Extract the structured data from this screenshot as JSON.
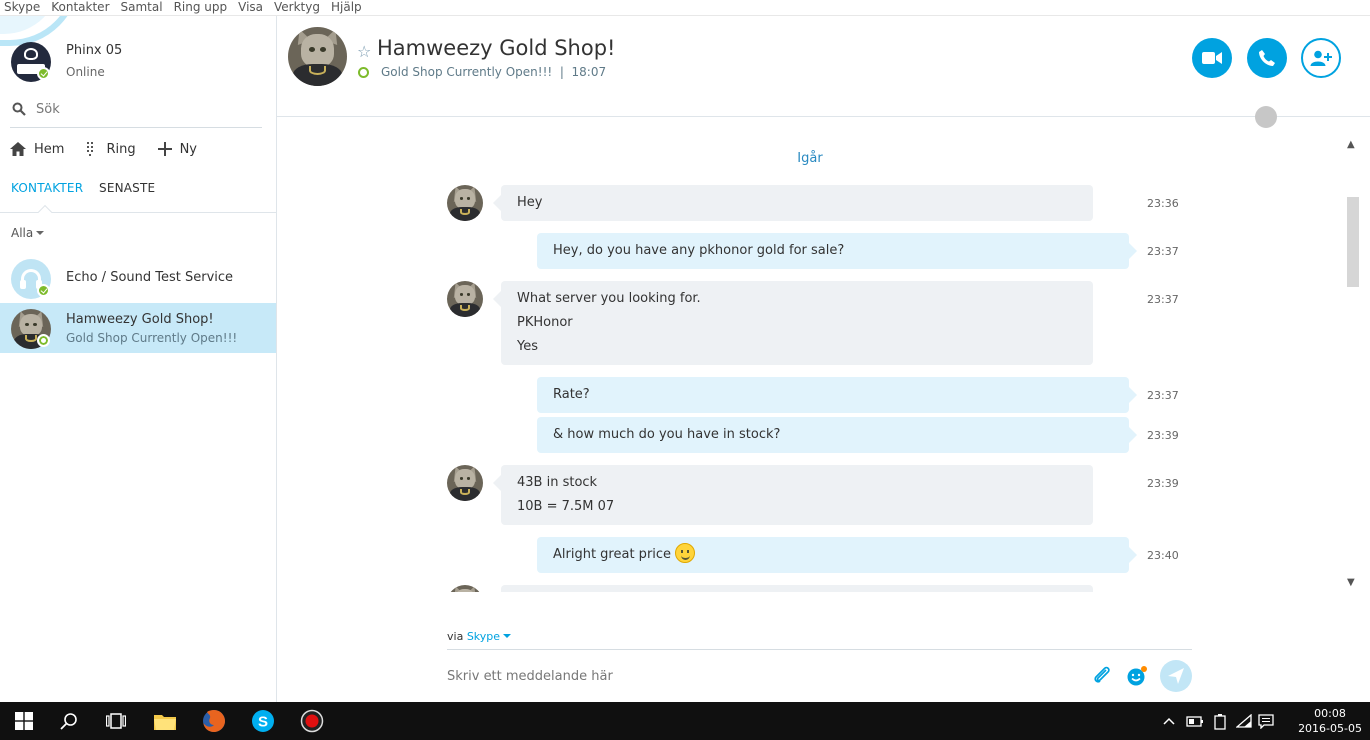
{
  "menu": [
    "Skype",
    "Kontakter",
    "Samtal",
    "Ring upp",
    "Visa",
    "Verktyg",
    "Hjälp"
  ],
  "me": {
    "name": "Phinx 05",
    "status": "Online",
    "avatar_icon": "giants-logo-icon"
  },
  "search": {
    "placeholder": "Sök"
  },
  "nav": {
    "home": "Hem",
    "call": "Ring",
    "new": "Ny"
  },
  "tabs": {
    "contacts": "KONTAKTER",
    "recent": "SENASTE"
  },
  "filter": {
    "label": "Alla"
  },
  "contacts": [
    {
      "name": "Echo / Sound Test Service",
      "sub": "",
      "status": "online"
    },
    {
      "name": "Hamweezy Gold Shop!",
      "sub": "Gold Shop Currently Open!!!",
      "status": "ring",
      "selected": true
    }
  ],
  "chat": {
    "title": "Hamweezy Gold Shop!",
    "mood": "Gold Shop Currently Open!!!",
    "local_time": "18:07",
    "date_separator": "Igår",
    "accent": "#00a2e0"
  },
  "messages": [
    {
      "dir": "in",
      "lines": [
        "Hey"
      ],
      "time": "23:36"
    },
    {
      "dir": "out",
      "lines": [
        "Hey, do you have any pkhonor gold for sale?"
      ],
      "time": "23:37"
    },
    {
      "dir": "in",
      "lines": [
        "What server you looking for.",
        "PKHonor",
        "Yes"
      ],
      "time": "23:37"
    },
    {
      "dir": "out",
      "lines": [
        "Rate?"
      ],
      "time": "23:37"
    },
    {
      "dir": "out",
      "lines": [
        "& how much do you have in stock?"
      ],
      "time": "23:39"
    },
    {
      "dir": "in",
      "lines": [
        "43B in stock",
        "10B = 7.5M 07"
      ],
      "time": "23:39"
    },
    {
      "dir": "out",
      "lines": [
        "Alright great price"
      ],
      "time": "23:40",
      "emoticon": "smile-emoticon"
    }
  ],
  "composer": {
    "via_prefix": "via",
    "via_service": "Skype",
    "placeholder": "Skriv ett meddelande här"
  },
  "taskbar": {
    "time": "00:08",
    "date": "2016-05-05"
  }
}
